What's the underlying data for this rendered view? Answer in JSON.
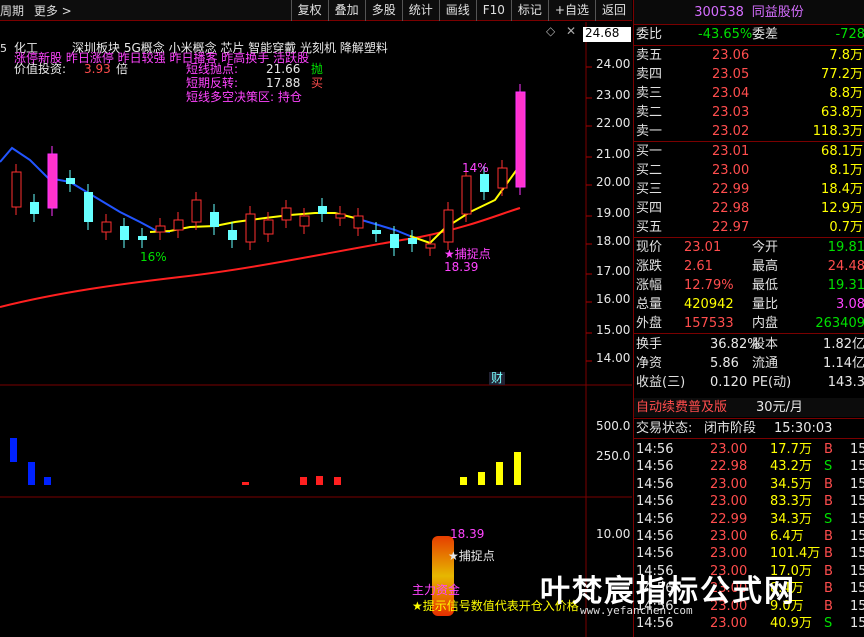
{
  "topbar": {
    "period": "周期",
    "more": "更多 >",
    "toolbar": [
      "复权",
      "叠加",
      "多股",
      "统计",
      "画线",
      "F10",
      "标记",
      "+自选",
      "返回"
    ]
  },
  "chart": {
    "sector_label": "化工",
    "concepts": "深圳板块  5G概念 小米概念 芯片 智能穿戴 光刻机 降解塑料",
    "flash": "涨停新股 昨日涨停 昨日较强 昨日播客 昨高换手 活跃股",
    "value_label": "价值投资:",
    "value_num": "3.93",
    "value_unit": "倍",
    "short_point_label": "短线抛点:",
    "short_point_val": "21.66",
    "short_point_sig": "抛",
    "short_rev_label": "短期反转:",
    "short_rev_val": "17.88",
    "short_rev_sig": "买",
    "strategy": "短线多空决策区: 持仓",
    "cur_price_tag": "24.68",
    "pct_14": "14%",
    "pct_16": "16%",
    "catch_label": "★捕捉点",
    "catch_val": "18.39",
    "fin_badge": "财",
    "price_axis": [
      "24.00",
      "23.00",
      "22.00",
      "21.00",
      "20.00",
      "19.00",
      "18.00",
      "17.00",
      "16.00",
      "15.00",
      "14.00"
    ],
    "vol_axis": [
      "500.0",
      "250.0"
    ],
    "ind_axis": [
      "10.00"
    ],
    "ind_val": "18.39",
    "ind_catch": "★捕捉点",
    "ind_main": "主力资金",
    "ind_footer": "★提示信号数值代表开仓入价格"
  },
  "panel": {
    "code": "300538",
    "name": "同益股份",
    "weibi_label": "委比",
    "weibi": "-43.65%",
    "weicha_label": "委差",
    "weicha": "-728",
    "sells": [
      {
        "label": "卖五",
        "price": "23.06",
        "vol": "7.8万"
      },
      {
        "label": "卖四",
        "price": "23.05",
        "vol": "77.2万"
      },
      {
        "label": "卖三",
        "price": "23.04",
        "vol": "8.8万"
      },
      {
        "label": "卖二",
        "price": "23.03",
        "vol": "63.8万"
      },
      {
        "label": "卖一",
        "price": "23.02",
        "vol": "118.3万"
      }
    ],
    "buys": [
      {
        "label": "买一",
        "price": "23.01",
        "vol": "68.1万"
      },
      {
        "label": "买二",
        "price": "23.00",
        "vol": "8.1万"
      },
      {
        "label": "买三",
        "price": "22.99",
        "vol": "18.4万"
      },
      {
        "label": "买四",
        "price": "22.98",
        "vol": "12.9万"
      },
      {
        "label": "买五",
        "price": "22.97",
        "vol": "0.7万"
      }
    ],
    "stats": [
      {
        "l1": "现价",
        "v1": "23.01",
        "l2": "今开",
        "v2": "19.81"
      },
      {
        "l1": "涨跌",
        "v1": "2.61",
        "l2": "最高",
        "v2": "24.48"
      },
      {
        "l1": "涨幅",
        "v1": "12.79%",
        "l2": "最低",
        "v2": "19.31"
      },
      {
        "l1": "总量",
        "v1": "420942",
        "l2": "量比",
        "v2": "3.08"
      },
      {
        "l1": "外盘",
        "v1": "157533",
        "l2": "内盘",
        "v2": "263409"
      }
    ],
    "stats2": [
      {
        "l1": "换手",
        "v1": "36.82%",
        "l2": "股本",
        "v2": "1.82亿"
      },
      {
        "l1": "净资",
        "v1": "5.86",
        "l2": "流通",
        "v2": "1.14亿"
      },
      {
        "l1": "收益(三)",
        "v1": "0.120",
        "l2": "PE(动)",
        "v2": "143.3"
      }
    ],
    "promo": "自动续费普及版",
    "promo_price": "30元/月",
    "status_label": "交易状态:",
    "status": "闭市阶段",
    "status_time": "15:30:03",
    "ticks": [
      {
        "t": "14:56",
        "p": "23.00",
        "v": "17.7万",
        "s": "B",
        "n": "15"
      },
      {
        "t": "14:56",
        "p": "22.98",
        "v": "43.2万",
        "s": "S",
        "n": "15"
      },
      {
        "t": "14:56",
        "p": "23.00",
        "v": "34.5万",
        "s": "B",
        "n": "15"
      },
      {
        "t": "14:56",
        "p": "23.00",
        "v": "83.3万",
        "s": "B",
        "n": "15"
      },
      {
        "t": "14:56",
        "p": "22.99",
        "v": "34.3万",
        "s": "S",
        "n": "15"
      },
      {
        "t": "14:56",
        "p": "23.00",
        "v": "6.4万",
        "s": "B",
        "n": "15"
      },
      {
        "t": "14:56",
        "p": "23.00",
        "v": "101.4万",
        "s": "B",
        "n": "15"
      },
      {
        "t": "14:56",
        "p": "23.00",
        "v": "17.0万",
        "s": "B",
        "n": "15"
      },
      {
        "t": "14:56",
        "p": "23.00",
        "v": "8.4万",
        "s": "B",
        "n": "15"
      },
      {
        "t": "14:56",
        "p": "23.00",
        "v": "9.0万",
        "s": "B",
        "n": "15"
      },
      {
        "t": "14:56",
        "p": "23.00",
        "v": "40.9万",
        "s": "S",
        "n": "15"
      }
    ]
  },
  "watermark": "叶梵宸指标公式网",
  "watermark_url": "www.yefanchen.com"
}
